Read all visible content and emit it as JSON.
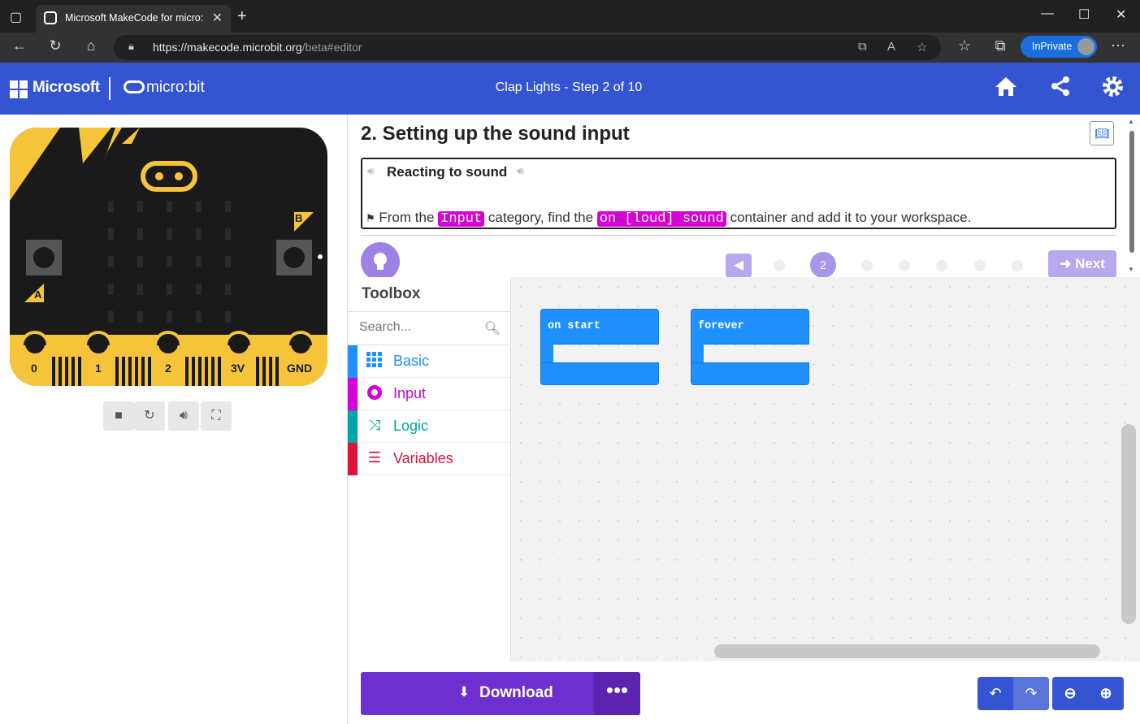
{
  "browser": {
    "tab_title": "Microsoft MakeCode for micro:bit",
    "url_host": "https://makecode.microbit.org",
    "url_path": "/beta#editor",
    "inprivate_label": "InPrivate"
  },
  "header": {
    "brand": "Microsoft",
    "product": "micro:bit",
    "title": "Clap Lights",
    "step": "Step 2 of 10"
  },
  "tutorial": {
    "title": "2. Setting up the sound input",
    "box_heading": "Reacting to sound",
    "step_prefix": "From the",
    "step_category": "Input",
    "step_middle": "category, find the",
    "step_block": "on [loud] sound",
    "step_suffix": "container and add it to your workspace.",
    "current_step": "2",
    "next_label": "Next"
  },
  "simulator": {
    "pins": [
      "0",
      "1",
      "2",
      "3V",
      "GND"
    ],
    "button_a": "A",
    "button_b": "B"
  },
  "toolbox": {
    "title": "Toolbox",
    "search_placeholder": "Search...",
    "categories": [
      {
        "label": "Basic",
        "color": "#1e90ff",
        "icon": "grid-icon"
      },
      {
        "label": "Input",
        "color": "#d400d4",
        "icon": "circle-dot-icon"
      },
      {
        "label": "Logic",
        "color": "#00a4a6",
        "icon": "shuffle-icon"
      },
      {
        "label": "Variables",
        "color": "#dc143c",
        "icon": "lines-icon"
      }
    ]
  },
  "workspace": {
    "blocks": [
      {
        "label": "on start"
      },
      {
        "label": "forever"
      }
    ]
  },
  "footer": {
    "download_label": "Download",
    "more_label": "•••"
  },
  "colors": {
    "header": "#3454d1",
    "download": "#6d2fd0",
    "block": "#1e90ff",
    "board_yellow": "#f5c43b"
  }
}
